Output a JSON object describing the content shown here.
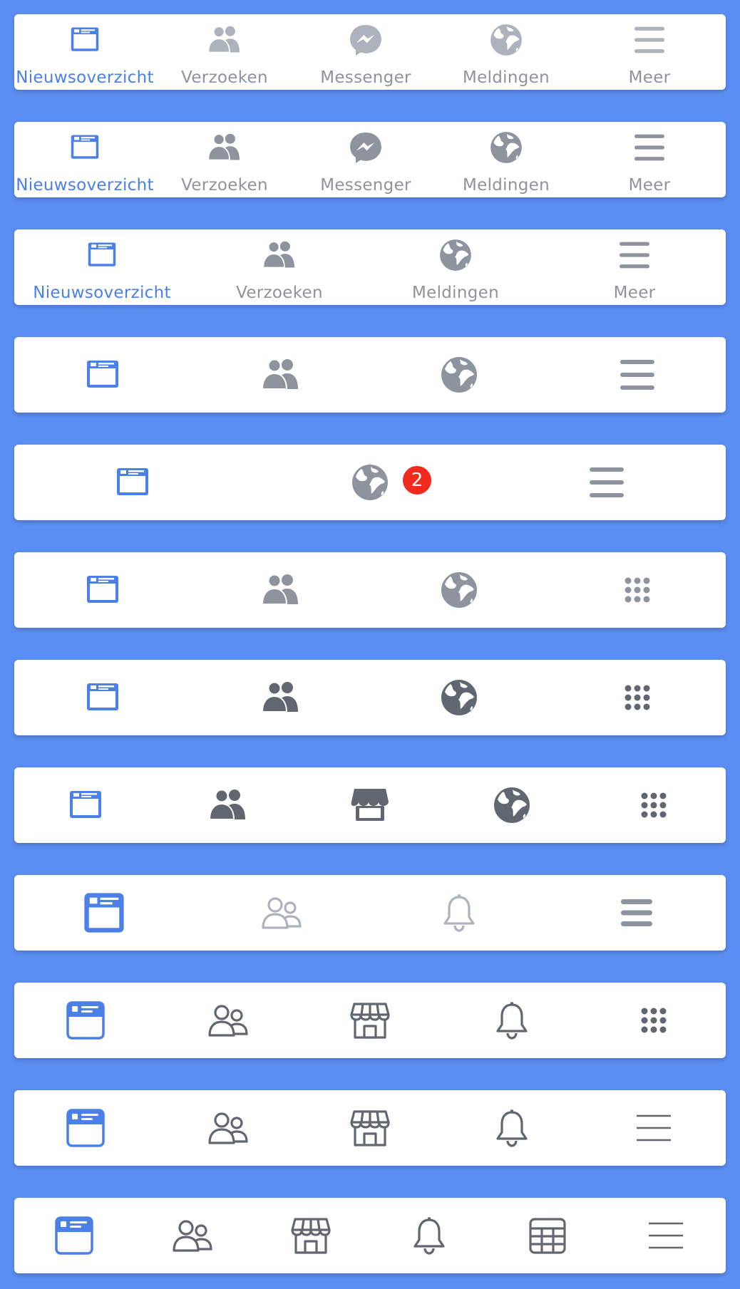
{
  "colors": {
    "background": "#5b8ef2",
    "active": "#4a80e8",
    "grey_light": "#adb3bd",
    "grey_mid": "#8d949e",
    "grey_dark": "#606770",
    "badge": "#f02a1c"
  },
  "bars": [
    {
      "tabs": [
        {
          "icon": "news-feed-icon",
          "label": "Nieuwsoverzicht",
          "active": true
        },
        {
          "icon": "friend-requests-icon",
          "label": "Verzoeken"
        },
        {
          "icon": "messenger-icon",
          "label": "Messenger"
        },
        {
          "icon": "notifications-globe-icon",
          "label": "Meldingen"
        },
        {
          "icon": "menu-icon",
          "label": "Meer"
        }
      ]
    },
    {
      "tabs": [
        {
          "icon": "news-feed-icon",
          "label": "Nieuwsoverzicht",
          "active": true
        },
        {
          "icon": "friend-requests-icon",
          "label": "Verzoeken"
        },
        {
          "icon": "messenger-icon",
          "label": "Messenger"
        },
        {
          "icon": "notifications-globe-icon",
          "label": "Meldingen"
        },
        {
          "icon": "menu-icon",
          "label": "Meer"
        }
      ]
    },
    {
      "tabs": [
        {
          "icon": "news-feed-icon",
          "label": "Nieuwsoverzicht",
          "active": true
        },
        {
          "icon": "friend-requests-icon",
          "label": "Verzoeken"
        },
        {
          "icon": "notifications-globe-icon",
          "label": "Meldingen"
        },
        {
          "icon": "menu-icon",
          "label": "Meer"
        }
      ]
    },
    {
      "tabs": [
        {
          "icon": "news-feed-icon",
          "active": true
        },
        {
          "icon": "friend-requests-icon"
        },
        {
          "icon": "notifications-globe-icon"
        },
        {
          "icon": "menu-icon"
        }
      ]
    },
    {
      "tabs": [
        {
          "icon": "news-feed-icon",
          "active": true
        },
        {
          "icon": "notifications-globe-icon",
          "badge": "2"
        },
        {
          "icon": "menu-icon"
        }
      ]
    },
    {
      "tabs": [
        {
          "icon": "news-feed-icon",
          "active": true
        },
        {
          "icon": "friend-requests-icon"
        },
        {
          "icon": "notifications-globe-icon"
        },
        {
          "icon": "app-grid-icon"
        }
      ]
    },
    {
      "tabs": [
        {
          "icon": "news-feed-icon",
          "active": true
        },
        {
          "icon": "friend-requests-icon"
        },
        {
          "icon": "notifications-globe-icon"
        },
        {
          "icon": "app-grid-icon"
        }
      ]
    },
    {
      "tabs": [
        {
          "icon": "news-feed-icon",
          "active": true
        },
        {
          "icon": "friend-requests-icon"
        },
        {
          "icon": "marketplace-icon"
        },
        {
          "icon": "notifications-globe-icon"
        },
        {
          "icon": "app-grid-icon"
        }
      ]
    },
    {
      "tabs": [
        {
          "icon": "news-feed-icon",
          "active": true
        },
        {
          "icon": "friends-outline-icon"
        },
        {
          "icon": "bell-icon"
        },
        {
          "icon": "menu-icon"
        }
      ]
    },
    {
      "tabs": [
        {
          "icon": "news-feed-icon",
          "active": true
        },
        {
          "icon": "friends-outline-icon"
        },
        {
          "icon": "marketplace-outline-icon"
        },
        {
          "icon": "bell-icon"
        },
        {
          "icon": "app-grid-icon"
        }
      ]
    },
    {
      "tabs": [
        {
          "icon": "news-feed-icon",
          "active": true
        },
        {
          "icon": "friends-outline-icon"
        },
        {
          "icon": "marketplace-outline-icon"
        },
        {
          "icon": "bell-icon"
        },
        {
          "icon": "menu-thin-icon"
        }
      ]
    },
    {
      "tabs": [
        {
          "icon": "news-feed-icon",
          "active": true
        },
        {
          "icon": "friends-outline-icon"
        },
        {
          "icon": "marketplace-outline-icon"
        },
        {
          "icon": "bell-icon"
        },
        {
          "icon": "calendar-icon"
        },
        {
          "icon": "menu-thin-icon"
        }
      ]
    }
  ]
}
